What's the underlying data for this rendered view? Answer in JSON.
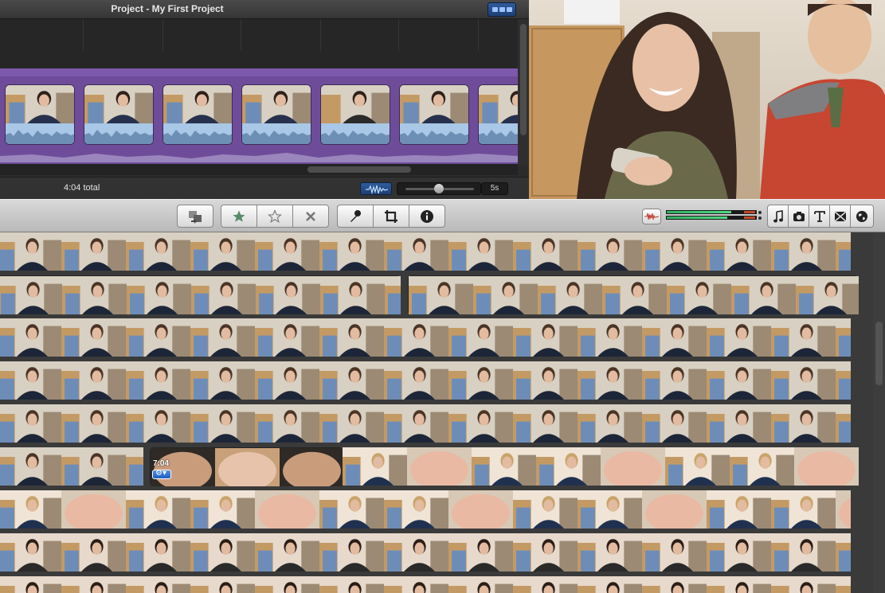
{
  "project": {
    "title": "Project - My First Project",
    "total": "4:04 total",
    "zoom_value": "5s"
  },
  "toolbar": {
    "buttons": [
      {
        "name": "swap-events-button",
        "icon": "swap-icon"
      },
      {
        "name": "mark-favorite-button",
        "icon": "star-filled-icon"
      },
      {
        "name": "unmark-button",
        "icon": "star-outline-icon"
      },
      {
        "name": "reject-button",
        "icon": "x-icon"
      },
      {
        "name": "voiceover-button",
        "icon": "microphone-icon"
      },
      {
        "name": "crop-button",
        "icon": "crop-icon"
      },
      {
        "name": "inspector-button",
        "icon": "info-icon"
      }
    ],
    "browsers": [
      {
        "name": "music-browser-button",
        "icon": "music-note-icon"
      },
      {
        "name": "photo-browser-button",
        "icon": "camera-icon"
      },
      {
        "name": "title-browser-button",
        "icon": "title-t-icon"
      },
      {
        "name": "transition-browser-button",
        "icon": "transition-icon"
      },
      {
        "name": "maps-browser-button",
        "icon": "globe-icon"
      }
    ],
    "audio_level_left": 0.72,
    "audio_level_right": 0.68
  },
  "event_browser": {
    "clip_duration": "7:04"
  },
  "colors": {
    "project_band": "#6f4c9a",
    "audio_wave": "#a9c7e6",
    "selection_blue": "#2f5c9e"
  }
}
